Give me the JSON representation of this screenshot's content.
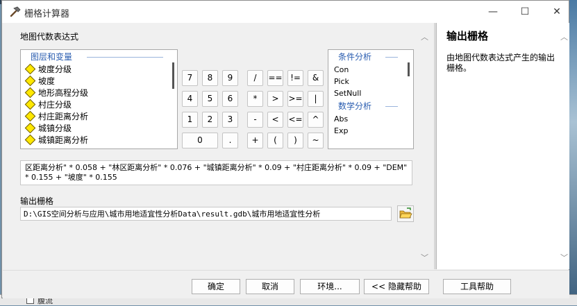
{
  "window": {
    "title": "栅格计算器",
    "minimize": "—",
    "maximize": "☐",
    "close": "✕",
    "title_icon": "hammer-icon"
  },
  "expression_label": "地图代数表达式",
  "variables": {
    "group_label": "图层和变量",
    "items": [
      "坡度分级",
      "坡度",
      "地形高程分级",
      "村庄分级",
      "村庄距离分析",
      "城镇分级",
      "城镇距离分析"
    ]
  },
  "calculator": {
    "row1": [
      "7",
      "8",
      "9",
      "/",
      "==",
      "!=",
      "&"
    ],
    "row2": [
      "4",
      "5",
      "6",
      "*",
      ">",
      ">=",
      "|"
    ],
    "row3": [
      "1",
      "2",
      "3",
      "-",
      "<",
      "<=",
      "^"
    ],
    "row4": [
      "0",
      ".",
      "+",
      "(",
      ")",
      "~"
    ]
  },
  "functions": {
    "group1_label": "条件分析",
    "group1_items": [
      "Con",
      "Pick",
      "SetNull"
    ],
    "group2_label": "数学分析",
    "group2_items": [
      "Abs",
      "Exp"
    ]
  },
  "expression": "区距离分析\" * 0.058 + \"林区距离分析\" * 0.076 + \"城镇距离分析\" * 0.09 + \"村庄距离分析\" * 0.09 + \"DEM\" * 0.155 + \"坡度\" * 0.155",
  "output": {
    "label": "输出栅格",
    "path": "D:\\GIS空间分析与应用\\城市用地适宜性分析Data\\result.gdb\\城市用地适宜性分析",
    "browse_icon": "folder-open-icon"
  },
  "help": {
    "title": "输出栅格",
    "text": "由地图代数表达式产生的输出栅格。"
  },
  "buttons": {
    "ok": "确定",
    "cancel": "取消",
    "env": "环境...",
    "hide_help": "<< 隐藏帮助",
    "tool_help": "工具帮助"
  },
  "scroll": {
    "up": "︿",
    "down": "﹀"
  },
  "background": {
    "tree_item": "腹流"
  },
  "colors": {
    "accent_blue": "#2a5db0",
    "diamond_yellow": "#ffe800"
  }
}
